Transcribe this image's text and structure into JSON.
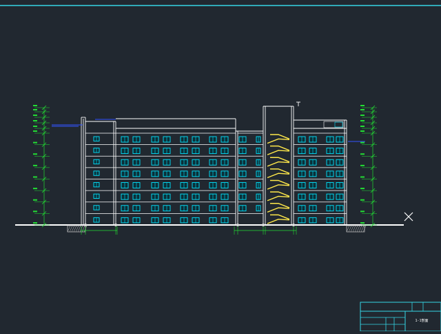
{
  "drawing": {
    "background": "#212830",
    "colors": {
      "frame": "#35d6e6",
      "outline": "#ffffff",
      "window": "#00e5ff",
      "window_fill": "#0a2f38",
      "dimension": "#22dd33",
      "annotation": "#3355ff",
      "stair": "#ffe94a",
      "ground": "#ffffff",
      "hatch": "#bbbbbb"
    },
    "storeys": 8,
    "icons": {
      "close": "close-icon",
      "north_marker": "cross-marker-icon"
    }
  },
  "title_block": {
    "sheet_label": "1-1剖面"
  }
}
